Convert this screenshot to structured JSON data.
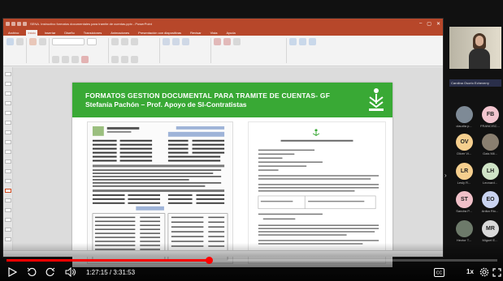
{
  "ppt": {
    "doc_title": "SENA. Instructivo formatos documentales para tramite de cuentas.pptx - PowerPoint",
    "tabs": [
      "Archivo",
      "Inicio",
      "Insertar",
      "Diseño",
      "Transiciones",
      "Animaciones",
      "Presentación con diapositivas",
      "Revisar",
      "Vista",
      "Ayuda"
    ],
    "active_tab": "Inicio"
  },
  "slide": {
    "title": "FORMATOS GESTION DOCUMENTAL PARA TRAMITE DE CUENTAS- GF",
    "subtitle": "Stefanía Pachón – Prof. Apoyo de SI-Contratistas"
  },
  "participants": {
    "presenter_name": "Carolina Osorio Echeverry",
    "people": [
      {
        "initials": "",
        "name": "claudia p...",
        "photo": true
      },
      {
        "initials": "FB",
        "name": "FRANCISC...",
        "color": "#f2c5cf"
      },
      {
        "initials": "OV",
        "name": "Oliver Vi...",
        "color": "#f6cf8e"
      },
      {
        "initials": "",
        "name": "Gais Mil...",
        "photo": true
      },
      {
        "initials": "LR",
        "name": "Lesly R...",
        "color": "#f6cf8e"
      },
      {
        "initials": "LH",
        "name": "Leonard...",
        "color": "#cfe3c6"
      },
      {
        "initials": "ST",
        "name": "Sandra P...",
        "color": "#f0c0c8"
      },
      {
        "initials": "EO",
        "name": "Anika Rio...",
        "color": "#c9d3f0"
      },
      {
        "initials": "",
        "name": "Hector T...",
        "photo": true
      },
      {
        "initials": "MR",
        "name": "Miguel E...",
        "color": "#d9d9d9"
      }
    ]
  },
  "player": {
    "time_current": "1:27:15",
    "time_total": "3:31:53",
    "time_separator": " / ",
    "progress": 0.412,
    "speed": "1x"
  }
}
